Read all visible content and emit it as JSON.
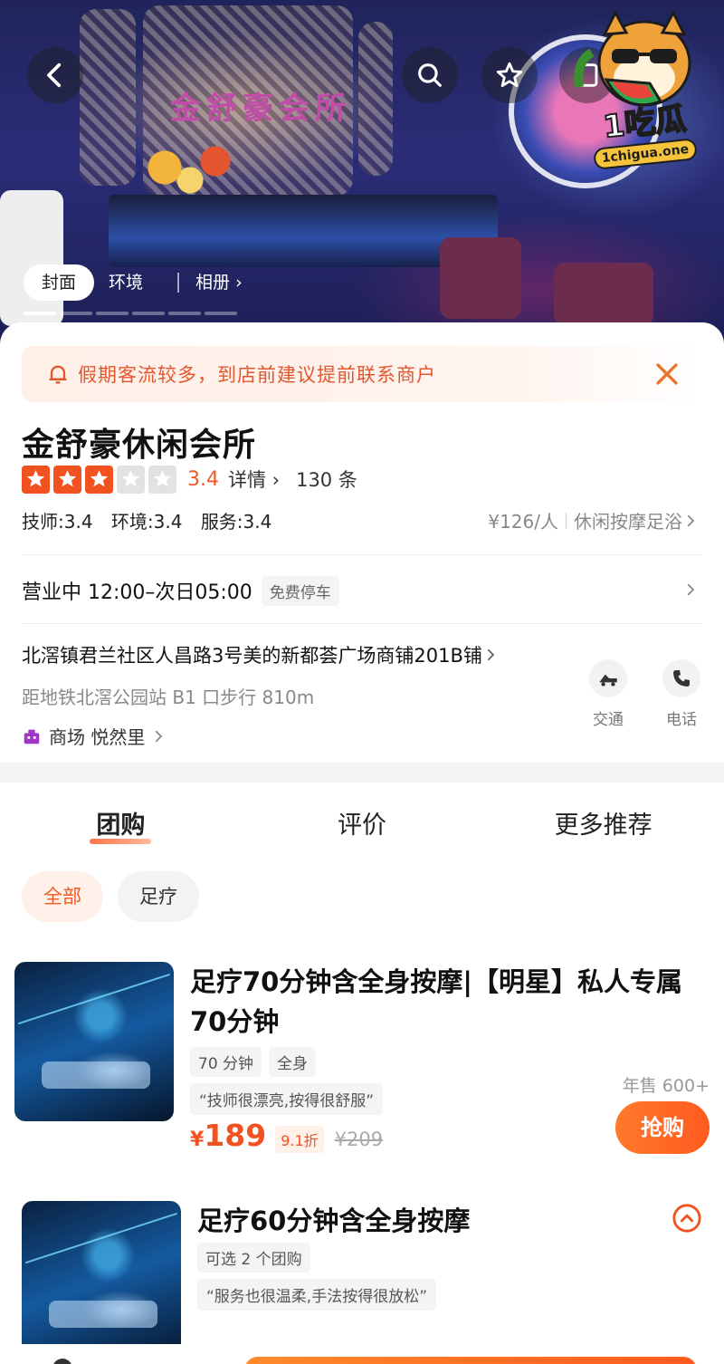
{
  "hero": {
    "sign_text": "金舒豪会所",
    "tabs": [
      "封面",
      "环境",
      "相册"
    ],
    "album_chevron": "›",
    "watermark": {
      "text": "1吃瓜",
      "sub": "1chigua.one"
    }
  },
  "notice": {
    "text": "假期客流较多，到店前建议提前联系商户"
  },
  "shop": {
    "name": "金舒豪休闲会所",
    "rating": 3.4,
    "rating_text": "3.4",
    "stars_filled": 3,
    "stars_total": 5,
    "details_label": "详情",
    "review_count": "130 条",
    "scores": [
      "技师:3.4",
      "环境:3.4",
      "服务:3.4"
    ],
    "price_per_person": "¥126/人",
    "category": "休闲按摩足浴",
    "hours": "营业中 12:00–次日05:00",
    "parking_tag": "免费停车",
    "address": "北滘镇君兰社区人昌路3号美的新都荟广场商铺201B铺",
    "metro": "距地铁北滘公园站 B1 口步行 810m",
    "mall": "商场 悦然里",
    "actions": [
      {
        "label": "交通",
        "icon": "transit-icon"
      },
      {
        "label": "电话",
        "icon": "phone-icon"
      }
    ]
  },
  "section_tabs": [
    "团购",
    "评价",
    "更多推荐"
  ],
  "filters": [
    "全部",
    "足疗"
  ],
  "deals": [
    {
      "title": "足疗70分钟含全身按摩|【明星】私人专属70分钟",
      "tags": [
        "70 分钟",
        "全身"
      ],
      "quote": "“技师很漂亮,按得很舒服”",
      "currency": "¥",
      "price": "189",
      "discount": "9.1折",
      "original_price": "¥209",
      "sold": "年售 600+",
      "buy_label": "抢购"
    },
    {
      "title": "足疗60分钟含全身按摩",
      "tags": [
        "可选 2 个团购"
      ],
      "quote": "“服务也很温柔,手法按得很放松”"
    }
  ],
  "colors": {
    "accent": "#f2521f",
    "notice_bg": "#fff0e8",
    "mall_icon": "#a036c8"
  }
}
